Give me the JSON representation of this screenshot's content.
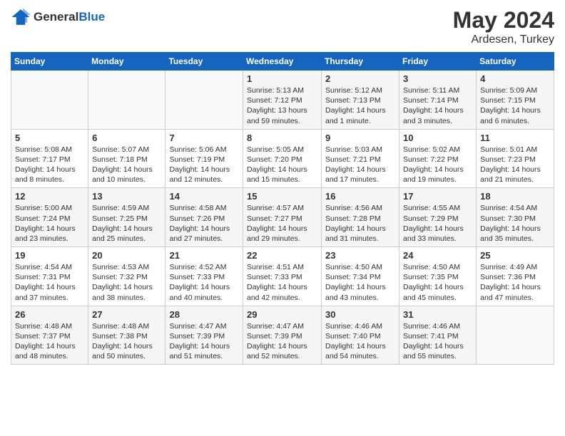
{
  "header": {
    "logo_general": "General",
    "logo_blue": "Blue",
    "title": "May 2024",
    "location": "Ardesen, Turkey"
  },
  "weekdays": [
    "Sunday",
    "Monday",
    "Tuesday",
    "Wednesday",
    "Thursday",
    "Friday",
    "Saturday"
  ],
  "weeks": [
    [
      {
        "day": "",
        "info": ""
      },
      {
        "day": "",
        "info": ""
      },
      {
        "day": "",
        "info": ""
      },
      {
        "day": "1",
        "info": "Sunrise: 5:13 AM\nSunset: 7:12 PM\nDaylight: 13 hours and 59 minutes."
      },
      {
        "day": "2",
        "info": "Sunrise: 5:12 AM\nSunset: 7:13 PM\nDaylight: 14 hours and 1 minute."
      },
      {
        "day": "3",
        "info": "Sunrise: 5:11 AM\nSunset: 7:14 PM\nDaylight: 14 hours and 3 minutes."
      },
      {
        "day": "4",
        "info": "Sunrise: 5:09 AM\nSunset: 7:15 PM\nDaylight: 14 hours and 6 minutes."
      }
    ],
    [
      {
        "day": "5",
        "info": "Sunrise: 5:08 AM\nSunset: 7:17 PM\nDaylight: 14 hours and 8 minutes."
      },
      {
        "day": "6",
        "info": "Sunrise: 5:07 AM\nSunset: 7:18 PM\nDaylight: 14 hours and 10 minutes."
      },
      {
        "day": "7",
        "info": "Sunrise: 5:06 AM\nSunset: 7:19 PM\nDaylight: 14 hours and 12 minutes."
      },
      {
        "day": "8",
        "info": "Sunrise: 5:05 AM\nSunset: 7:20 PM\nDaylight: 14 hours and 15 minutes."
      },
      {
        "day": "9",
        "info": "Sunrise: 5:03 AM\nSunset: 7:21 PM\nDaylight: 14 hours and 17 minutes."
      },
      {
        "day": "10",
        "info": "Sunrise: 5:02 AM\nSunset: 7:22 PM\nDaylight: 14 hours and 19 minutes."
      },
      {
        "day": "11",
        "info": "Sunrise: 5:01 AM\nSunset: 7:23 PM\nDaylight: 14 hours and 21 minutes."
      }
    ],
    [
      {
        "day": "12",
        "info": "Sunrise: 5:00 AM\nSunset: 7:24 PM\nDaylight: 14 hours and 23 minutes."
      },
      {
        "day": "13",
        "info": "Sunrise: 4:59 AM\nSunset: 7:25 PM\nDaylight: 14 hours and 25 minutes."
      },
      {
        "day": "14",
        "info": "Sunrise: 4:58 AM\nSunset: 7:26 PM\nDaylight: 14 hours and 27 minutes."
      },
      {
        "day": "15",
        "info": "Sunrise: 4:57 AM\nSunset: 7:27 PM\nDaylight: 14 hours and 29 minutes."
      },
      {
        "day": "16",
        "info": "Sunrise: 4:56 AM\nSunset: 7:28 PM\nDaylight: 14 hours and 31 minutes."
      },
      {
        "day": "17",
        "info": "Sunrise: 4:55 AM\nSunset: 7:29 PM\nDaylight: 14 hours and 33 minutes."
      },
      {
        "day": "18",
        "info": "Sunrise: 4:54 AM\nSunset: 7:30 PM\nDaylight: 14 hours and 35 minutes."
      }
    ],
    [
      {
        "day": "19",
        "info": "Sunrise: 4:54 AM\nSunset: 7:31 PM\nDaylight: 14 hours and 37 minutes."
      },
      {
        "day": "20",
        "info": "Sunrise: 4:53 AM\nSunset: 7:32 PM\nDaylight: 14 hours and 38 minutes."
      },
      {
        "day": "21",
        "info": "Sunrise: 4:52 AM\nSunset: 7:33 PM\nDaylight: 14 hours and 40 minutes."
      },
      {
        "day": "22",
        "info": "Sunrise: 4:51 AM\nSunset: 7:33 PM\nDaylight: 14 hours and 42 minutes."
      },
      {
        "day": "23",
        "info": "Sunrise: 4:50 AM\nSunset: 7:34 PM\nDaylight: 14 hours and 43 minutes."
      },
      {
        "day": "24",
        "info": "Sunrise: 4:50 AM\nSunset: 7:35 PM\nDaylight: 14 hours and 45 minutes."
      },
      {
        "day": "25",
        "info": "Sunrise: 4:49 AM\nSunset: 7:36 PM\nDaylight: 14 hours and 47 minutes."
      }
    ],
    [
      {
        "day": "26",
        "info": "Sunrise: 4:48 AM\nSunset: 7:37 PM\nDaylight: 14 hours and 48 minutes."
      },
      {
        "day": "27",
        "info": "Sunrise: 4:48 AM\nSunset: 7:38 PM\nDaylight: 14 hours and 50 minutes."
      },
      {
        "day": "28",
        "info": "Sunrise: 4:47 AM\nSunset: 7:39 PM\nDaylight: 14 hours and 51 minutes."
      },
      {
        "day": "29",
        "info": "Sunrise: 4:47 AM\nSunset: 7:39 PM\nDaylight: 14 hours and 52 minutes."
      },
      {
        "day": "30",
        "info": "Sunrise: 4:46 AM\nSunset: 7:40 PM\nDaylight: 14 hours and 54 minutes."
      },
      {
        "day": "31",
        "info": "Sunrise: 4:46 AM\nSunset: 7:41 PM\nDaylight: 14 hours and 55 minutes."
      },
      {
        "day": "",
        "info": ""
      }
    ]
  ]
}
